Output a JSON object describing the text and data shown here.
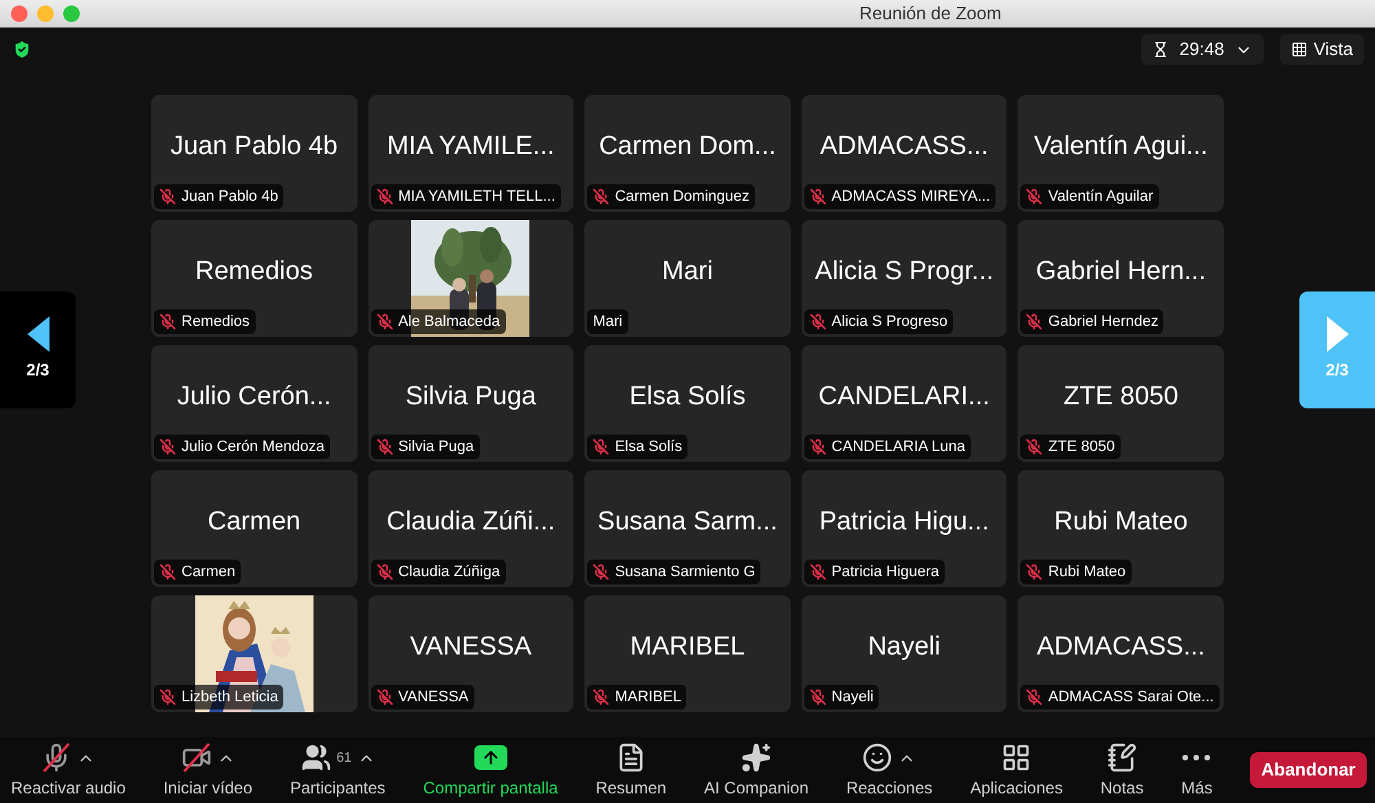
{
  "window": {
    "title": "Reunión de Zoom"
  },
  "top_bar": {
    "timer": "29:48",
    "view_button": "Vista"
  },
  "tiles": [
    {
      "kind": "name",
      "display_name": "Juan Pablo 4b",
      "label": "Juan Pablo 4b",
      "muted": true
    },
    {
      "kind": "name",
      "display_name": "MIA YAMILE...",
      "label": "MIA YAMILETH TELL...",
      "muted": true
    },
    {
      "kind": "name",
      "display_name": "Carmen Dom...",
      "label": "Carmen Dominguez",
      "muted": true
    },
    {
      "kind": "name",
      "display_name": "ADMACASS...",
      "label": "ADMACASS MIREYA...",
      "muted": true
    },
    {
      "kind": "name",
      "display_name": "Valentín Agui...",
      "label": "Valentín Aguilar",
      "muted": true
    },
    {
      "kind": "name",
      "display_name": "Remedios",
      "label": "Remedios",
      "muted": true
    },
    {
      "kind": "picture",
      "label": "Ale Balmaceda",
      "muted": true
    },
    {
      "kind": "name",
      "display_name": "Mari",
      "label": "Mari",
      "muted": false
    },
    {
      "kind": "name",
      "display_name": "Alicia S Progr...",
      "label": "Alicia S Progreso",
      "muted": true
    },
    {
      "kind": "name",
      "display_name": "Gabriel Hern...",
      "label": "Gabriel Herndez",
      "muted": true
    },
    {
      "kind": "name",
      "display_name": "Julio Cerón...",
      "label": "Julio Cerón Mendoza",
      "muted": true
    },
    {
      "kind": "name",
      "display_name": "Silvia Puga",
      "label": "Silvia Puga",
      "muted": true
    },
    {
      "kind": "name",
      "display_name": "Elsa Solís",
      "label": "Elsa Solís",
      "muted": true
    },
    {
      "kind": "name",
      "display_name": "CANDELARI...",
      "label": "CANDELARIA Luna",
      "muted": true
    },
    {
      "kind": "name",
      "display_name": "ZTE 8050",
      "label": "ZTE 8050",
      "muted": true
    },
    {
      "kind": "name",
      "display_name": "Carmen",
      "label": "Carmen",
      "muted": true
    },
    {
      "kind": "name",
      "display_name": "Claudia Zúñi...",
      "label": "Claudia Zúñiga",
      "muted": true
    },
    {
      "kind": "name",
      "display_name": "Susana Sarm...",
      "label": "Susana Sarmiento G",
      "muted": true
    },
    {
      "kind": "name",
      "display_name": "Patricia Higu...",
      "label": "Patricia Higuera",
      "muted": true
    },
    {
      "kind": "name",
      "display_name": "Rubi Mateo",
      "label": "Rubi Mateo",
      "muted": true
    },
    {
      "kind": "picture",
      "label": "Lizbeth Leticia",
      "muted": true
    },
    {
      "kind": "name",
      "display_name": "VANESSA",
      "label": "VANESSA",
      "muted": true
    },
    {
      "kind": "name",
      "display_name": "MARIBEL",
      "label": "MARIBEL",
      "muted": true
    },
    {
      "kind": "name",
      "display_name": "Nayeli",
      "label": "Nayeli",
      "muted": true
    },
    {
      "kind": "name",
      "display_name": "ADMACASS...",
      "label": "ADMACASS Sarai Ote...",
      "muted": true
    }
  ],
  "pager": {
    "previous": "2/3",
    "next": "2/3"
  },
  "toolbar": [
    {
      "label": "Reactivar audio",
      "off": true,
      "has_menu": true
    },
    {
      "label": "Iniciar vídeo",
      "off": true,
      "has_menu": true
    },
    {
      "label": "Participantes",
      "count": "61",
      "has_menu": true
    },
    {
      "label": "Compartir pantalla",
      "highlighted": true
    },
    {
      "label": "Resumen"
    },
    {
      "label": "AI Companion"
    },
    {
      "label": "Reacciones",
      "has_menu": true
    },
    {
      "label": "Aplicaciones"
    },
    {
      "label": "Notas"
    },
    {
      "label": "Más"
    }
  ],
  "leave_button": "Abandonar"
}
